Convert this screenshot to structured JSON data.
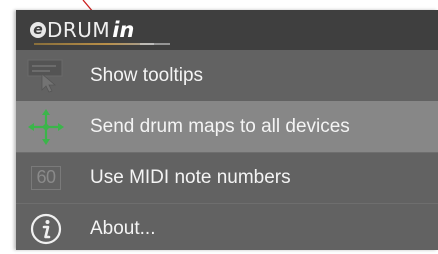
{
  "logo": {
    "e": "e",
    "drum": "DRUM",
    "in": "in"
  },
  "menu": {
    "items": [
      {
        "label": "Show tooltips",
        "icon": "cursor-tooltip-icon",
        "highlighted": false
      },
      {
        "label": "Send drum maps to all devices",
        "icon": "send-arrows-icon",
        "highlighted": true
      },
      {
        "label": "Use MIDI note numbers",
        "icon": "midi-number-icon",
        "icon_text": "60",
        "highlighted": false
      },
      {
        "label": "About...",
        "icon": "info-icon",
        "highlighted": false
      }
    ]
  },
  "colors": {
    "header_bg": "#3f3f3f",
    "menu_bg": "#626262",
    "highlight_bg": "#878787",
    "text": "#f4f4f4",
    "accent_green": "#3bb54a",
    "annotation_red": "#cc1f1f"
  }
}
